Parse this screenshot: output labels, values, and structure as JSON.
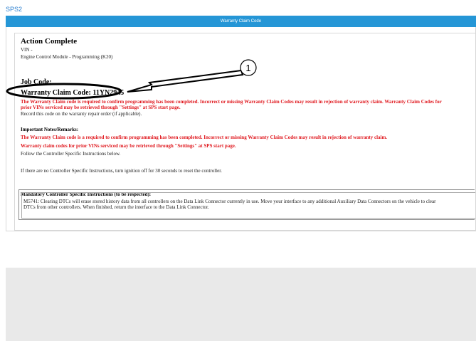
{
  "app": {
    "title": "SPS2"
  },
  "window": {
    "title": "Warranty Claim Code"
  },
  "content": {
    "heading": "Action Complete",
    "vin": "VIN -",
    "module": "Engine Control Module - Programming (K20)",
    "job_code_label": "Job Code:",
    "warranty_label": "Warranty Claim Code: 11YN2945",
    "warning_line1": "The Warranty Claim code is required to confirm programming has been completed. Incorrect or missing Warranty Claim Codes may result in rejection of warranty claim. Warranty Claim Codes for",
    "warning_line2": "prior VINs serviced may be retrieved through \"Settings\" at SPS start page.",
    "record_note": "Record this code on the warranty repair order (if applicable).",
    "notes_heading": "Important Notes/Remarks:",
    "note_red1": "The Warranty Claim code is a required to confirm programming has been completed. Incorrect or missing Warranty Claim Codes may result in rejection of warranty claim.",
    "note_red2": "Warranty claim codes for prior VINs serviced may be retrieved through \"Settings\" at SPS start page.",
    "follow": "Follow the Controller Specific Instructions below.",
    "no_instructions": "If there are no Controller Specific Instructions, turn ignition off for 30 seconds to reset the controller.",
    "mandatory_heading": "Mandatory Controller Specific Instructions (to be respected):",
    "mandatory_line1": "M5741: Clearing DTCs will erase stored history data from all controllers on the Data Link Connector currently in use. Move your interface to any additional Auxiliary Data Connectors on the vehicle to clear",
    "mandatory_line2": "DTCs from other controllers. When finished, return the interface to the Data Link Connector."
  },
  "annotation": {
    "callout_number": "1"
  },
  "colors": {
    "accent": "#2596d6",
    "warning": "#e0191f"
  }
}
